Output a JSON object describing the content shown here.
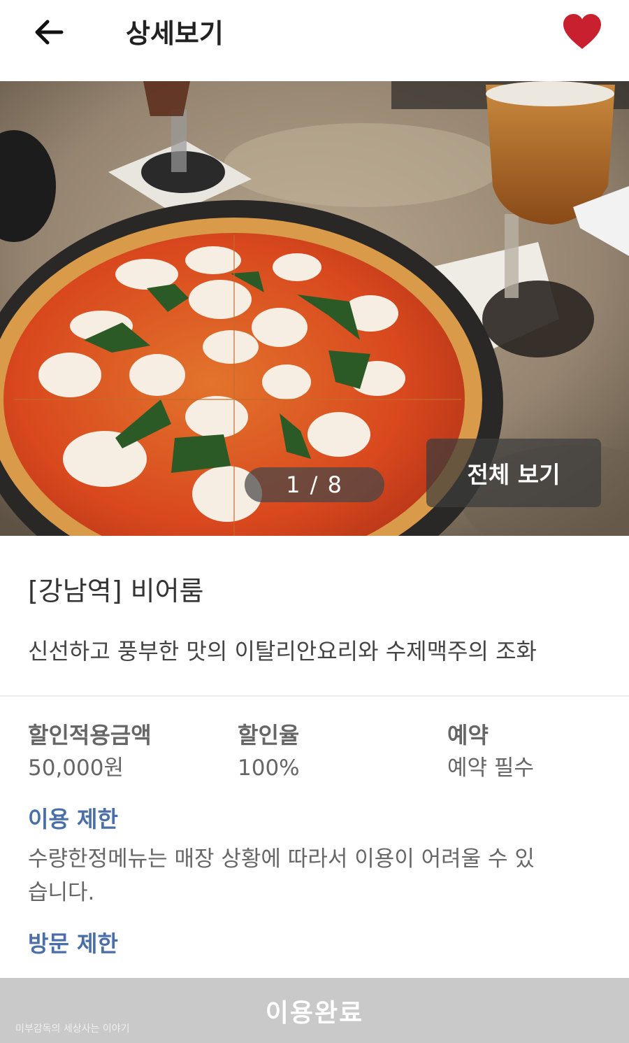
{
  "header": {
    "title": "상세보기",
    "back_icon": "arrow-left-icon",
    "favorite_icon": "heart-filled-icon",
    "favorite_color": "#c8202f"
  },
  "gallery": {
    "indicator": "1 / 8",
    "current_page": 1,
    "total_pages": 8,
    "view_all_label": "전체 보기"
  },
  "store": {
    "name": "[강남역] 비어룸",
    "description": "신선하고 풍부한 맛의 이탈리안요리와 수제맥주의 조화"
  },
  "info": {
    "discount_amount_label": "할인적용금액",
    "discount_amount_value": "50,000원",
    "discount_rate_label": "할인율",
    "discount_rate_value": "100%",
    "reservation_label": "예약",
    "reservation_value": "예약 필수"
  },
  "usage_restriction": {
    "title": "이용 제한",
    "body": "수량한정메뉴는 매장 상황에 따라서 이용이 어려울 수 있습니다."
  },
  "visit_restriction": {
    "title": "방문 제한"
  },
  "bottom_bar": {
    "label": "이용완료"
  },
  "watermark": "미부감독의 세상사는 이야기",
  "colors": {
    "accent_blue": "#4a6fa8",
    "bottom_bar": "#c9c9c9",
    "heart": "#c8202f"
  }
}
